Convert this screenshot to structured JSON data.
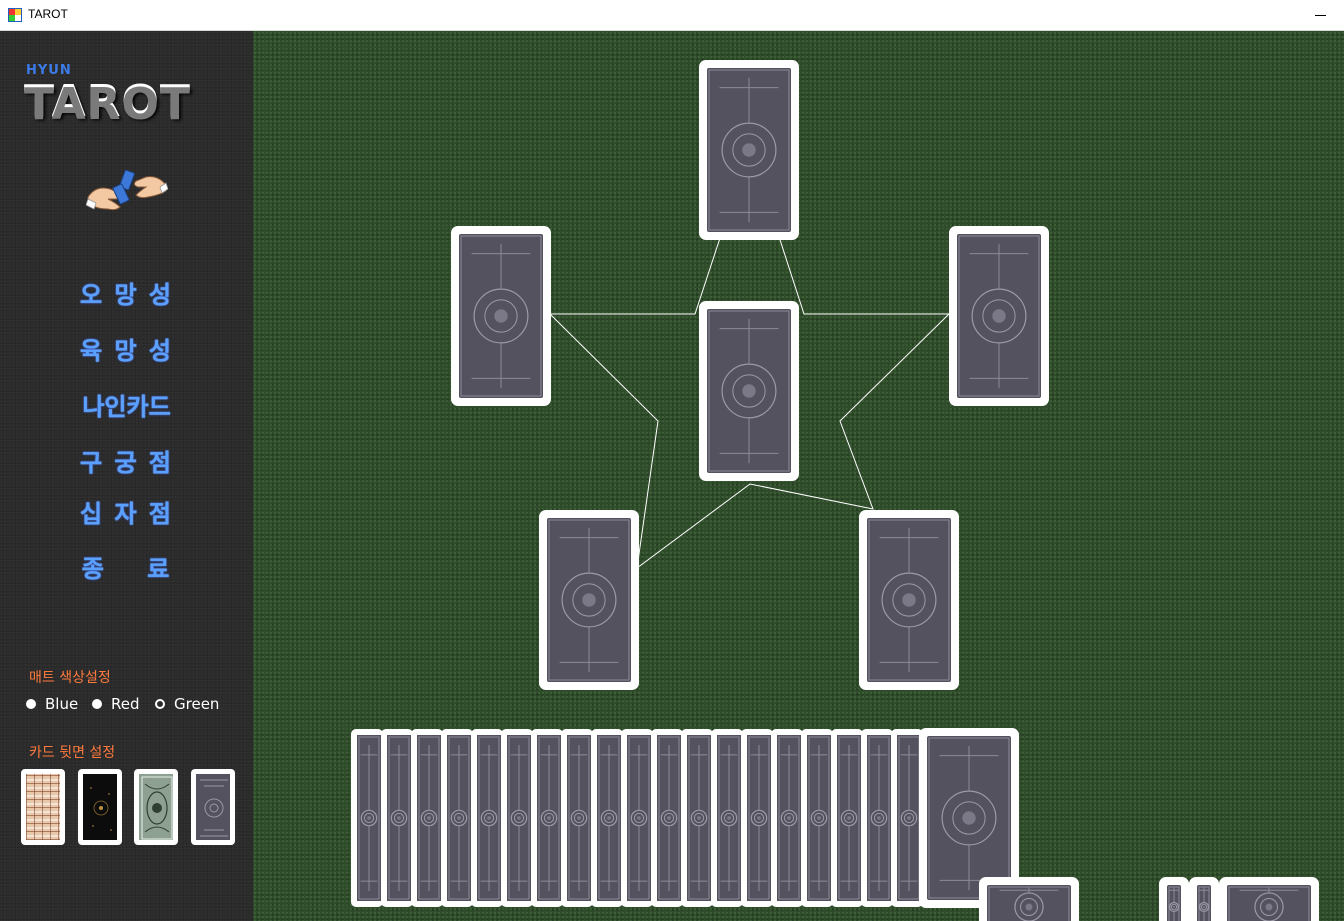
{
  "window": {
    "title": "TAROT"
  },
  "sidebar": {
    "logo_small": "HYUN",
    "logo_large": "TAROT",
    "menu": [
      {
        "label": "오 망 성"
      },
      {
        "label": "육 망 성"
      },
      {
        "label": "나인카드"
      },
      {
        "label": "구 궁 점"
      },
      {
        "label": "십 자 점"
      },
      {
        "label": "종    료"
      }
    ],
    "mat_color_label": "매트 색상설정",
    "mat_colors": [
      {
        "label": "Blue",
        "selected": false
      },
      {
        "label": "Red",
        "selected": false
      },
      {
        "label": "Green",
        "selected": true
      }
    ],
    "card_back_label": "카드 뒷면 설정",
    "card_backs": [
      "plaid-back",
      "black-star-back",
      "green-ornate-back",
      "gray-ornate-back"
    ]
  },
  "colors": {
    "mat_green": "#2e4b2a",
    "sidebar_bg": "#2b2b2b",
    "menu_blue": "#5aa0ff",
    "section_orange": "#ff7a3c"
  },
  "table": {
    "spread": "five-pointed star (오망성)",
    "placed_cards": 6,
    "deck_cards": 21
  }
}
